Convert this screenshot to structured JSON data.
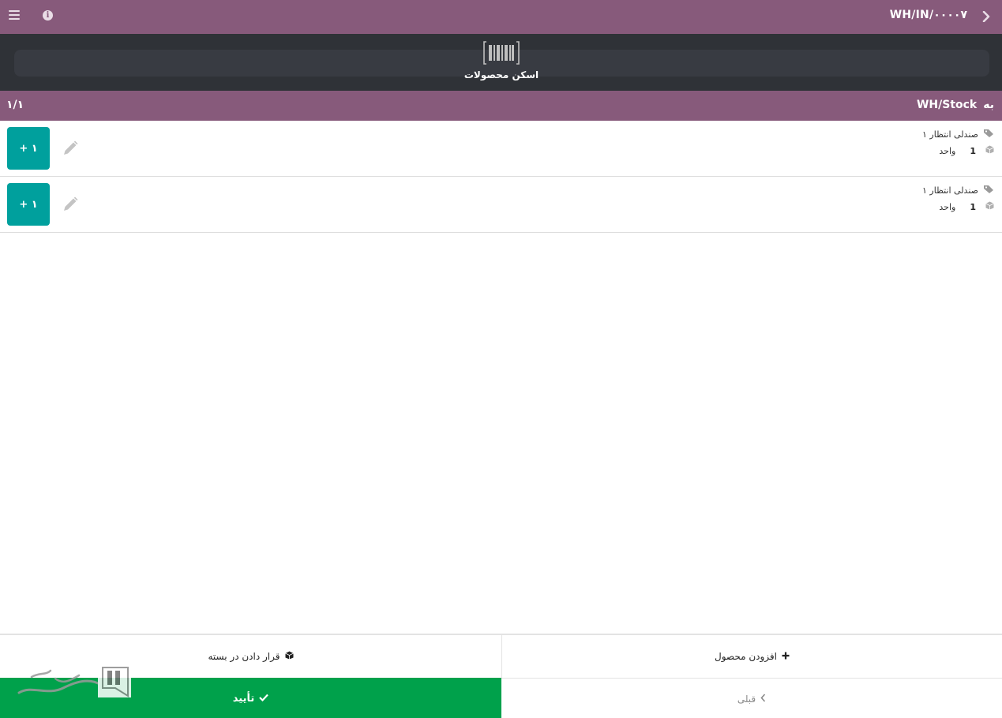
{
  "header": {
    "reference": "WH/IN/۰۰۰۰۷"
  },
  "scan": {
    "label": "اسکن محصولات"
  },
  "location": {
    "prefix": "به",
    "name": "WH/Stock",
    "page_counter": "۱/۱"
  },
  "lines": [
    {
      "product": "صندلی انتظار ۱",
      "quantity": "1",
      "uom": "واحد",
      "add_label": "+ ۱"
    },
    {
      "product": "صندلی انتظار ۱",
      "quantity": "1",
      "uom": "واحد",
      "add_label": "+ ۱"
    }
  ],
  "footer": {
    "add_product": "افزودن محصول",
    "put_in_pack": "قرار دادن در بسته",
    "previous": "قبلی",
    "validate": "تأیید"
  },
  "colors": {
    "primary": "#875a7b",
    "dark": "#2f3237",
    "teal": "#00a09d",
    "success": "#00a14b"
  }
}
